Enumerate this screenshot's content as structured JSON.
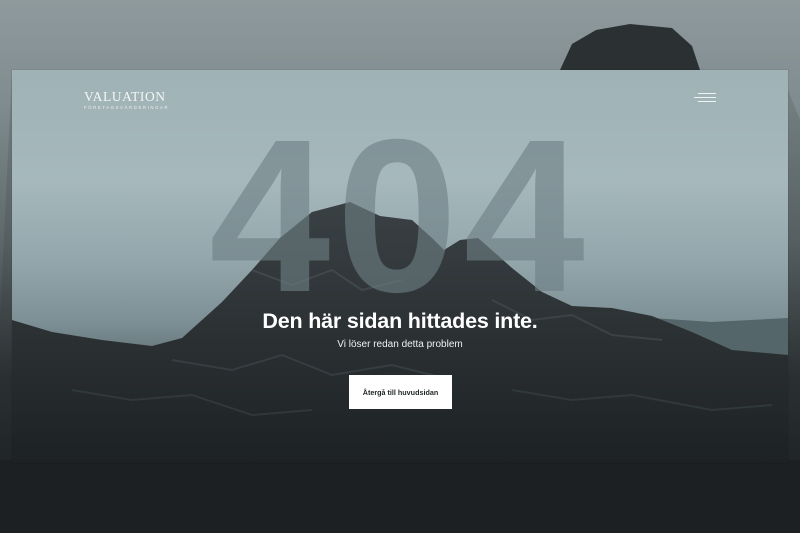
{
  "brand": {
    "name": "VALUATION",
    "tagline": "FÖRETAGSVÄRDERINGAR"
  },
  "error": {
    "code": "404",
    "headline": "Den här sidan hittades inte.",
    "subtext": "Vi löser redan detta problem",
    "button_label": "Återgå till huvudsidan"
  },
  "icons": {
    "menu": "hamburger-menu-icon"
  },
  "colors": {
    "sky": "#a6b8bc",
    "rock": "#2f3436",
    "button_bg": "#ffffff",
    "button_text": "#1e2426",
    "numeral": "#6e8085"
  }
}
